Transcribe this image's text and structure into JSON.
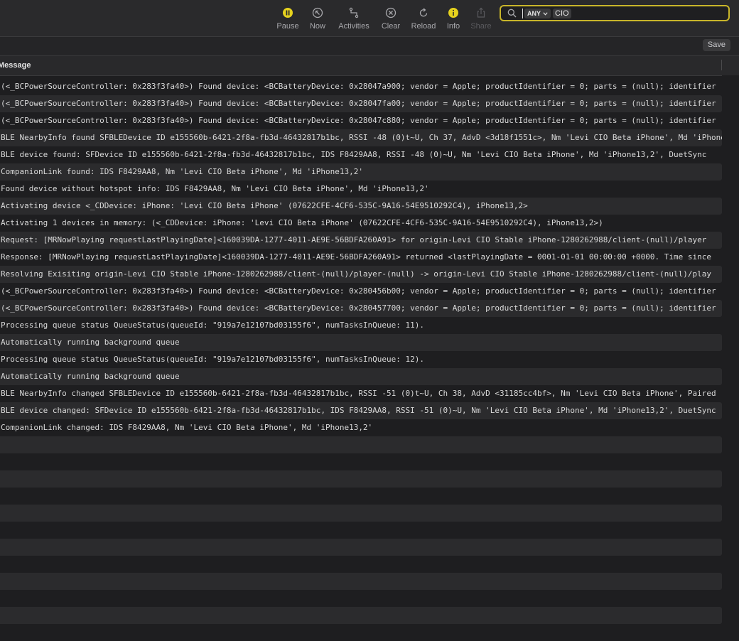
{
  "toolbar": {
    "pause_label": "Pause",
    "now_label": "Now",
    "activities_label": "Activities",
    "clear_label": "Clear",
    "reload_label": "Reload",
    "info_label": "Info",
    "share_label": "Share",
    "accent_color": "#e6d21e"
  },
  "search": {
    "scope": "ANY",
    "term": "CIO",
    "focus_color": "#c8b52a"
  },
  "savebar": {
    "save_label": "Save"
  },
  "column": {
    "message_label": "Message"
  },
  "rows": [
    "(<_BCPowerSourceController: 0x283f3fa40>) Found device: <BCBatteryDevice: 0x28047a900; vendor = Apple; productIdentifier = 0; parts = (null); identifier",
    "(<_BCPowerSourceController: 0x283f3fa40>) Found device: <BCBatteryDevice: 0x28047fa00; vendor = Apple; productIdentifier = 0; parts = (null); identifier",
    "(<_BCPowerSourceController: 0x283f3fa40>) Found device: <BCBatteryDevice: 0x28047c880; vendor = Apple; productIdentifier = 0; parts = (null); identifier",
    "BLE NearbyInfo found SFBLEDevice ID e155560b-6421-2f8a-fb3d-46432817b1bc, RSSI -48 (0)t~U, Ch 37, AdvD <3d18f1551c>, Nm 'Levi CIO Beta iPhone', Md 'iPhone",
    "BLE device found: SFDevice ID e155560b-6421-2f8a-fb3d-46432817b1bc, IDS F8429AA8, RSSI -48 (0)~U, Nm 'Levi CIO Beta iPhone', Md 'iPhone13,2', DuetSync",
    "CompanionLink found: IDS F8429AA8, Nm 'Levi CIO Beta iPhone', Md 'iPhone13,2'",
    "Found device without hotspot info: IDS F8429AA8, Nm 'Levi CIO Beta iPhone', Md 'iPhone13,2'",
    "Activating device <_CDDevice: iPhone: 'Levi CIO Beta iPhone' (07622CFE-4CF6-535C-9A16-54E9510292C4), iPhone13,2>",
    "Activating 1 devices in memory: (<_CDDevice: iPhone: 'Levi CIO Beta iPhone' (07622CFE-4CF6-535C-9A16-54E9510292C4), iPhone13,2>)",
    "Request: [MRNowPlaying requestLastPlayingDate]<160039DA-1277-4011-AE9E-56BDFA260A91> for origin-Levi CIO Stable iPhone-1280262988/client-(null)/player",
    "Response: [MRNowPlaying requestLastPlayingDate]<160039DA-1277-4011-AE9E-56BDFA260A91> returned <lastPlayingDate = 0001-01-01 00:00:00 +0000. Time since",
    "Resolving Exisiting origin-Levi CIO Stable iPhone-1280262988/client-(null)/player-(null) -> origin-Levi CIO Stable iPhone-1280262988/client-(null)/play",
    "(<_BCPowerSourceController: 0x283f3fa40>) Found device: <BCBatteryDevice: 0x280456b00; vendor = Apple; productIdentifier = 0; parts = (null); identifier",
    "(<_BCPowerSourceController: 0x283f3fa40>) Found device: <BCBatteryDevice: 0x280457700; vendor = Apple; productIdentifier = 0; parts = (null); identifier",
    "Processing queue status QueueStatus(queueId: \"919a7e12107bd03155f6\", numTasksInQueue: 11).",
    "Automatically running background queue",
    "Processing queue status QueueStatus(queueId: \"919a7e12107bd03155f6\", numTasksInQueue: 12).",
    "Automatically running background queue",
    "BLE NearbyInfo changed SFBLEDevice ID e155560b-6421-2f8a-fb3d-46432817b1bc, RSSI -51 (0)t~U, Ch 38, AdvD <31185cc4bf>, Nm 'Levi CIO Beta iPhone', Paired",
    "BLE device changed: SFDevice ID e155560b-6421-2f8a-fb3d-46432817b1bc, IDS F8429AA8, RSSI -51 (0)~U, Nm 'Levi CIO Beta iPhone', Md 'iPhone13,2', DuetSync",
    "CompanionLink changed: IDS F8429AA8, Nm 'Levi CIO Beta iPhone', Md 'iPhone13,2'",
    "",
    "",
    "",
    "",
    "",
    "",
    "",
    "",
    "",
    "",
    "",
    ""
  ]
}
